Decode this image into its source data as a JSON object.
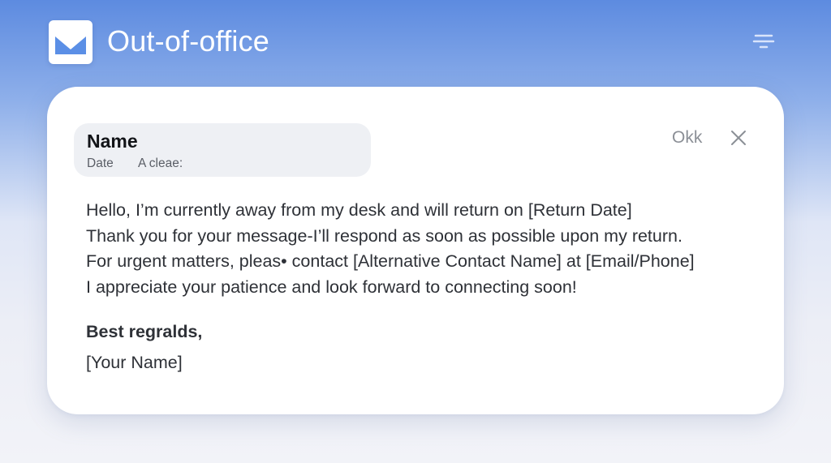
{
  "app": {
    "title": "Out-of-office",
    "logo_icon": "mail-logo-icon",
    "menu_icon": "menu-icon"
  },
  "card": {
    "sender": {
      "name": "Name",
      "date_label": "Date",
      "note": "A cleae:"
    },
    "ok_label": "Okk",
    "close_icon": "close-icon",
    "body_lines": [
      "Hello, I’m currently away from my desk and will return on [Return Date]",
      "Thank you for your message-I’ll respond as soon as possible upon my return.",
      "For urgent matters, pleas• contact [Alternative Contact Name] at [Email/Phone]",
      "I appreciate your patience and look forward to connecting soon!"
    ],
    "closing": "Best regralds,",
    "signature": "[Your Name]"
  },
  "colors": {
    "background_top": "#5d8be0",
    "background_bottom": "#f2f3f8",
    "card": "#ffffff",
    "sender_box": "#eef0f4",
    "text": "#2e3137",
    "muted": "#8b8f96"
  }
}
